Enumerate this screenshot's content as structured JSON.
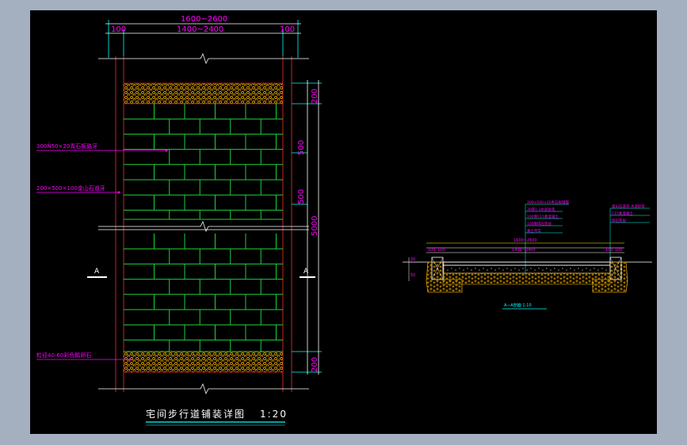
{
  "plan": {
    "dims_top": {
      "total": "1600~2600",
      "side_left": "100",
      "middle": "1400~2400",
      "side_right": "100"
    },
    "dims_right": {
      "band_top": "200",
      "brick_1": "500",
      "brick_2": "500",
      "total": "5000",
      "band_bottom": "200"
    },
    "section_marker_left": "A",
    "section_marker_right": "A",
    "labels": {
      "curb": "300Ñ50×20青石板路牙",
      "paver": "200×500×100金山石道牙",
      "pebble": "粒径40-60彩色鹅卵石"
    },
    "title": "宅间步行道铺装详图",
    "scale": "1:20"
  },
  "section": {
    "dims": {
      "total": "1600~2600",
      "middle": "1400~2400",
      "left_a": "100",
      "left_b": "100",
      "right_a": "100",
      "right_b": "100"
    },
    "left_dims": [
      "20",
      "50"
    ],
    "layer_notes_left": [
      "300×500×20青石板铺面",
      "30厚1:3水泥砂浆",
      "100厚C15素混凝土",
      "150厚碎石垫层",
      "素土夸实"
    ],
    "layer_notes_right": [
      "金山石道牙 水泥砂浆",
      "C15素混凝土",
      "碎石垫层"
    ],
    "title": "A—A剖面 1:10"
  },
  "colors": {
    "background": "#000000",
    "brick_lines": "#1dd13a",
    "dimension": "#ff00ff",
    "frame": "#cc2222",
    "pebble": "#e0a000",
    "extension": "#00ffff",
    "dim_line": "#ffff00"
  }
}
